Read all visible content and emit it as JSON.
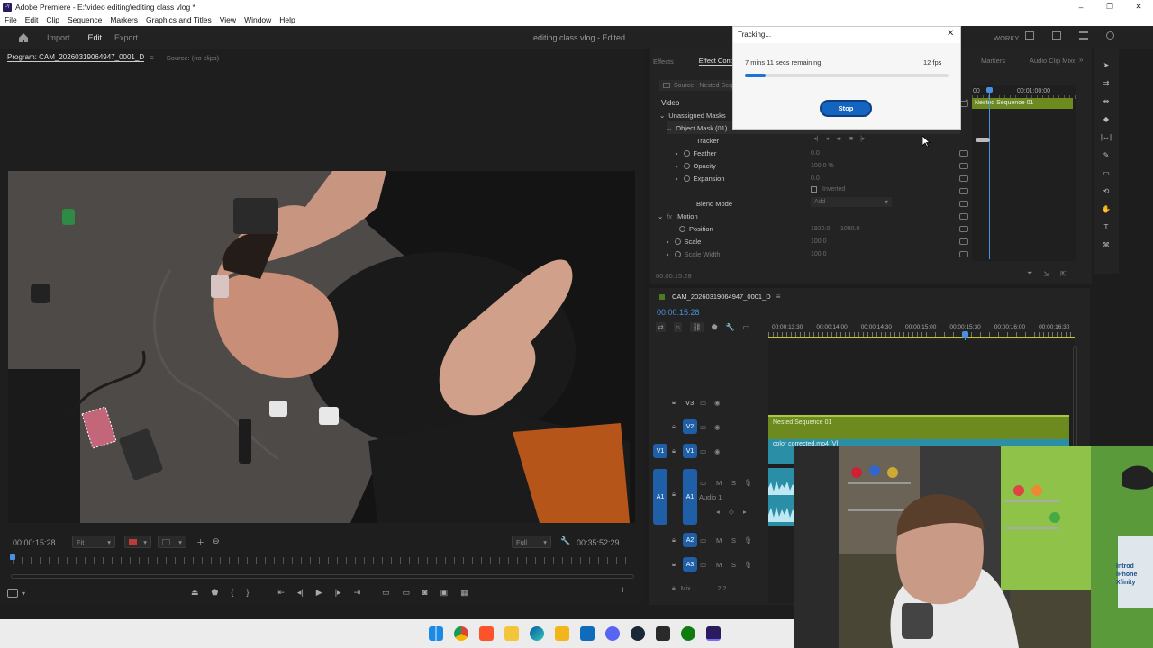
{
  "window": {
    "title": "Adobe Premiere - E:\\video editing\\editing class vlog *"
  },
  "menu": [
    "File",
    "Edit",
    "Clip",
    "Sequence",
    "Markers",
    "Graphics and Titles",
    "View",
    "Window",
    "Help"
  ],
  "header": {
    "workspaces": [
      "Import",
      "Edit",
      "Export"
    ],
    "project_title": "editing class vlog - Edited",
    "workspace_name": "WORKY"
  },
  "program_monitor": {
    "tab_label": "Program: CAM_20260319064947_0001_D",
    "source_label": "Source: (no clips)",
    "timecode": "00:00:15:28",
    "fit_label": "Fit",
    "quality_label": "Full",
    "duration": "00:35:52:29"
  },
  "effect_controls": {
    "tabs": [
      "Effects",
      "Effect Controls",
      "Markers",
      "Audio Clip Mixer"
    ],
    "source_label": "Source - Nested Seq",
    "section_video": "Video",
    "mini_timecode_start": "00",
    "mini_timecode_end": "00:01:00:00",
    "mini_clip_label": "Nested Sequence 01",
    "rows": {
      "unassigned_masks": "Unassigned Masks",
      "object_mask": "Object Mask (01)",
      "tracker": "Tracker",
      "feather": "Feather",
      "feather_val": "0.0",
      "opacity": "Opacity",
      "opacity_val": "100.0 %",
      "expansion": "Expansion",
      "expansion_val": "0.0",
      "inverted": "Inverted",
      "blend_mode": "Blend Mode",
      "blend_val": "Add",
      "motion": "Motion",
      "position": "Position",
      "position_x": "1920.0",
      "position_y": "1080.0",
      "scale": "Scale",
      "scale_val": "100.0",
      "scale_width": "Scale Width",
      "scale_width_val": "100.0"
    },
    "footer_timecode": "00:00:15:28"
  },
  "tracking_dialog": {
    "title": "Tracking...",
    "remaining": "7 mins 11 secs remaining",
    "fps": "12 fps",
    "progress": 0.1,
    "stop_label": "Stop"
  },
  "timeline": {
    "sequence_name": "CAM_20260319064947_0001_D",
    "timecode": "00:00:15:28",
    "ruler": [
      "00:00:13:30",
      "00:00:14:00",
      "00:00:14:30",
      "00:00:15:00",
      "00:00:15:30",
      "00:00:16:00",
      "00:00:16:30"
    ],
    "tracks": {
      "v3": "V3",
      "v2": "V2",
      "v1": "V1",
      "a1": "A1",
      "a2": "A2",
      "a3": "A3",
      "audio1_name": "Audio 1",
      "mix_label": "Mix",
      "mix_val": "2.2"
    },
    "clips": {
      "nested": "Nested Sequence 01",
      "color": "color corrected.mp4 [V]"
    }
  },
  "webcam": {
    "sign_text": "Introd iPhone Xfinity"
  },
  "taskbar": {
    "app_icons": [
      "windows-start-icon",
      "chrome-icon",
      "brave-icon",
      "file-explorer-icon",
      "edge-icon",
      "store-icon",
      "outlook-icon",
      "discord-icon",
      "steam-icon",
      "epic-games-icon",
      "xbox-icon",
      "premiere-icon"
    ]
  },
  "colors": {
    "accent_blue": "#1f5fa8",
    "clip_green": "#6d8a1e",
    "clip_teal": "#2a8fa6",
    "stop_button": "#1565c0"
  }
}
